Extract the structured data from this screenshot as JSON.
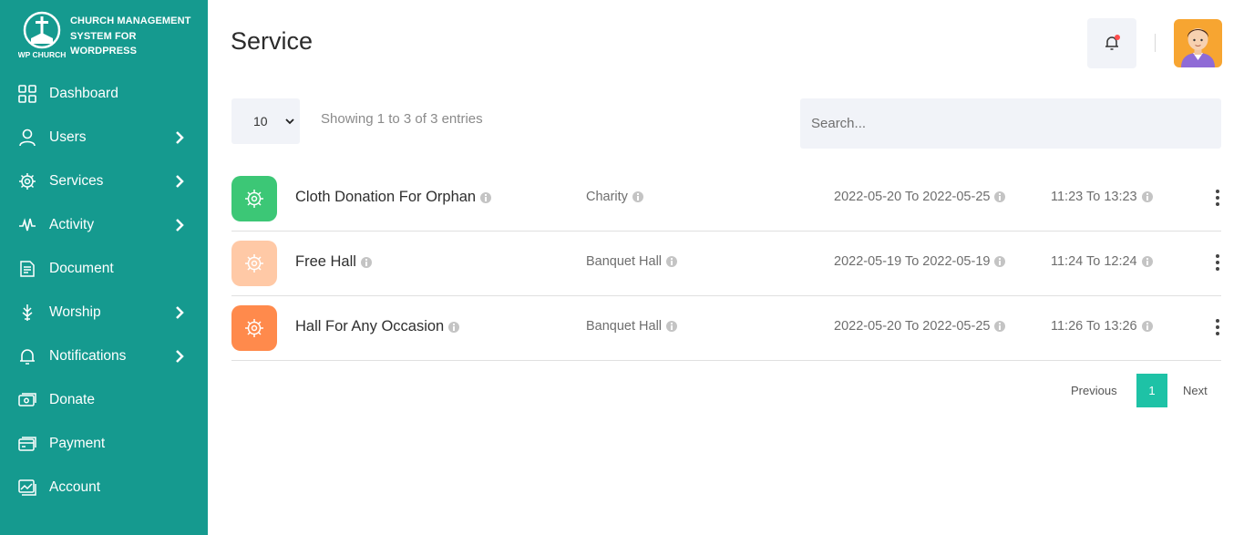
{
  "brand": {
    "name": "CHURCH MANAGEMENT SYSTEM FOR WORDPRESS",
    "logo_text": "WP CHURCH"
  },
  "sidebar": {
    "items": [
      {
        "label": "Dashboard",
        "icon": "dashboard-grid-icon",
        "has_submenu": false
      },
      {
        "label": "Users",
        "icon": "user-icon",
        "has_submenu": true
      },
      {
        "label": "Services",
        "icon": "services-gear-icon",
        "has_submenu": true
      },
      {
        "label": "Activity",
        "icon": "activity-pulse-icon",
        "has_submenu": true
      },
      {
        "label": "Document",
        "icon": "document-icon",
        "has_submenu": false
      },
      {
        "label": "Worship",
        "icon": "worship-icon",
        "has_submenu": true
      },
      {
        "label": "Notifications",
        "icon": "bell-icon",
        "has_submenu": true
      },
      {
        "label": "Donate",
        "icon": "donate-icon",
        "has_submenu": false
      },
      {
        "label": "Payment",
        "icon": "payment-icon",
        "has_submenu": false
      },
      {
        "label": "Account",
        "icon": "account-icon",
        "has_submenu": false
      }
    ]
  },
  "header": {
    "title": "Service",
    "notification_icon": "bell-icon",
    "has_unread": true
  },
  "table_controls": {
    "page_length": "10",
    "info": "Showing 1 to 3 of 3 entries",
    "search_placeholder": "Search..."
  },
  "rows": [
    {
      "name": "Cloth Donation For Orphan",
      "type": "Charity",
      "dates": "2022-05-20 To 2022-05-25",
      "time": "11:23 To 13:23",
      "icon_color": "#3cc776"
    },
    {
      "name": "Free Hall",
      "type": "Banquet Hall",
      "dates": "2022-05-19 To 2022-05-19",
      "time": "11:24 To 12:24",
      "icon_color": "#ffc9a6"
    },
    {
      "name": "Hall For Any Occasion",
      "type": "Banquet Hall",
      "dates": "2022-05-20 To 2022-05-25",
      "time": "11:26 To 13:26",
      "icon_color": "#ff8a4c"
    }
  ],
  "pagination": {
    "previous": "Previous",
    "current": "1",
    "next": "Next"
  },
  "colors": {
    "sidebar": "#159a8f",
    "accent": "#1ec2a6"
  }
}
